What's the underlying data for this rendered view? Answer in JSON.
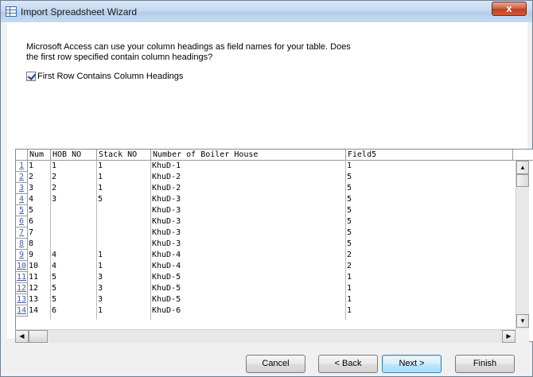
{
  "window": {
    "title": "Import Spreadsheet Wizard",
    "close_label": "x"
  },
  "instructions": {
    "text": "Microsoft Access can use your column headings as field names for your table. Does the first row specified contain column headings?"
  },
  "checkbox": {
    "label": "First Row Contains Column Headings",
    "checked": true
  },
  "grid": {
    "columns": [
      "Num",
      "HOB NO",
      "Stack NO",
      "Number of Boiler House",
      "Field5"
    ],
    "rows": [
      {
        "n": "1",
        "cells": [
          "1",
          "1",
          "1",
          "KhuD-1",
          "1"
        ]
      },
      {
        "n": "2",
        "cells": [
          "2",
          "2",
          "1",
          "KhuD-2",
          "5"
        ]
      },
      {
        "n": "3",
        "cells": [
          "3",
          "2",
          "1",
          "KhuD-2",
          "5"
        ]
      },
      {
        "n": "4",
        "cells": [
          "4",
          "3",
          "5",
          "KhuD-3",
          "5"
        ]
      },
      {
        "n": "5",
        "cells": [
          "5",
          "",
          "",
          "KhuD-3",
          "5"
        ]
      },
      {
        "n": "6",
        "cells": [
          "6",
          "",
          "",
          "KhuD-3",
          "5"
        ]
      },
      {
        "n": "7",
        "cells": [
          "7",
          "",
          "",
          "KhuD-3",
          "5"
        ]
      },
      {
        "n": "8",
        "cells": [
          "8",
          "",
          "",
          "KhuD-3",
          "5"
        ]
      },
      {
        "n": "9",
        "cells": [
          "9",
          "4",
          "1",
          "KhuD-4",
          "2"
        ]
      },
      {
        "n": "10",
        "cells": [
          "10",
          "4",
          "1",
          "KhuD-4",
          "2"
        ]
      },
      {
        "n": "11",
        "cells": [
          "11",
          "5",
          "3",
          "KhuD-5",
          "1"
        ]
      },
      {
        "n": "12",
        "cells": [
          "12",
          "5",
          "3",
          "KhuD-5",
          "1"
        ]
      },
      {
        "n": "13",
        "cells": [
          "13",
          "5",
          "3",
          "KhuD-5",
          "1"
        ]
      },
      {
        "n": "14",
        "cells": [
          "14",
          "6",
          "1",
          "KhuD-6",
          "1"
        ]
      }
    ]
  },
  "buttons": {
    "cancel": "Cancel",
    "back": "< Back",
    "next": "Next >",
    "finish": "Finish"
  },
  "icons": {
    "scroll_up": "▲",
    "scroll_down": "▼",
    "scroll_left": "◀",
    "scroll_right": "▶"
  }
}
